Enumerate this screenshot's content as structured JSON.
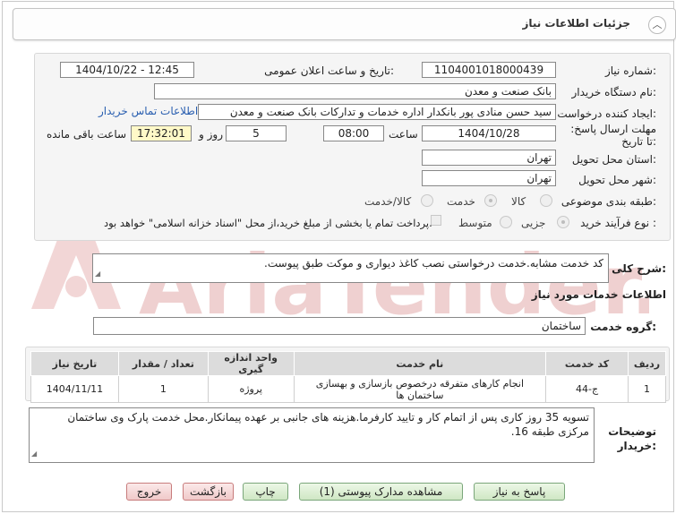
{
  "header": {
    "title": "جزئیات اطلاعات نیاز",
    "collapse_icon": "chevron-up-icon"
  },
  "fields": {
    "need_number_label": "شماره نیاز:",
    "need_number": "1104001018000439",
    "announce_label": "تاریخ و ساعت اعلان عمومی:",
    "announce_value": "1404/10/22 - 12:45",
    "buyer_org_label": "نام دستگاه خریدار:",
    "buyer_org": "بانک صنعت و معدن",
    "creator_label": "ایجاد کننده درخواست:",
    "creator": "سید حسن منادی پور بانکدار اداره خدمات و تدارکات بانک صنعت و معدن",
    "contact_link": "اطلاعات تماس خریدار",
    "deadline_label": "مهلت ارسال پاسخ: تا تاریخ:",
    "deadline_date": "1404/10/28",
    "time_label": "ساعت",
    "deadline_time": "08:00",
    "days_value": "5",
    "days_label": "روز و",
    "remaining_time": "17:32:01",
    "remaining_label": "ساعت باقی مانده",
    "province_label": "استان محل تحویل:",
    "province": "تهران",
    "city_label": "شهر محل تحویل:",
    "city": "تهران",
    "category_label": "طبقه بندی موضوعی:",
    "category_options": [
      "کالا",
      "خدمت",
      "کالا/خدمت"
    ],
    "category_selected": "خدمت",
    "process_label": "نوع فرآیند خرید :",
    "process_options": [
      "جزیی",
      "متوسط"
    ],
    "process_selected": "جزیی",
    "treasury_note": "پرداخت تمام یا بخشی از مبلغ خرید،از محل \"اسناد خزانه اسلامی\" خواهد بود."
  },
  "description": {
    "label": "شرح کلی نیاز:",
    "value": "کد خدمت مشابه.خدمت درخواستی نصب کاغذ دیواری و موکت طبق پیوست."
  },
  "services": {
    "section_title": "اطلاعات خدمات مورد نیاز",
    "group_label": "گروه خدمت:",
    "group_value": "ساختمان",
    "columns": [
      "ردیف",
      "کد خدمت",
      "نام خدمت",
      "واحد اندازه گیری",
      "تعداد / مقدار",
      "تاریخ نیاز"
    ],
    "rows": [
      {
        "row": "1",
        "code": "ج-44",
        "name": "انجام کارهای متفرقه درخصوص بازسازی و بهسازی ساختمان ها",
        "unit": "پروژه",
        "qty": "1",
        "date": "1404/11/11"
      }
    ]
  },
  "buyer_notes": {
    "label": "توضیحات خریدار:",
    "value": "تسویه 35 روز کاری پس از اتمام کار و تایید کارفرما.هزینه های جانبی بر عهده پیمانکار.محل خدمت پارک وی ساختمان مرکزی طبقه 16."
  },
  "buttons": {
    "reply": "پاسخ به نیاز",
    "view_docs": "مشاهده مدارک پیوستی (1)",
    "print": "چاپ",
    "back": "بازگشت",
    "exit": "خروج"
  },
  "colors": {
    "link": "#2a5fb0",
    "highlight": "#fff9c8",
    "button_green": "#cfe7c4",
    "button_red": "#f0c9c9"
  },
  "watermark": {
    "text": "AriaTender.net",
    "icon": "aria-logo-icon"
  }
}
